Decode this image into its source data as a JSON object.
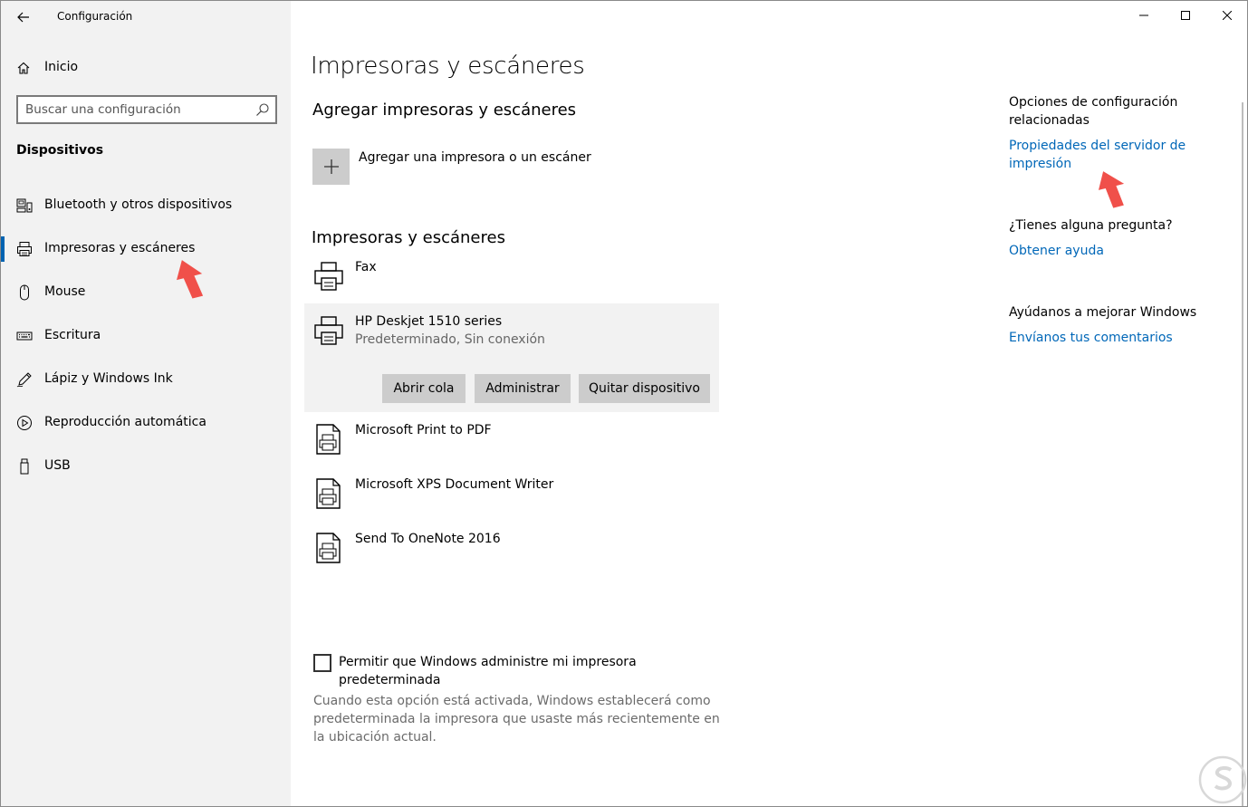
{
  "window": {
    "title": "Configuración"
  },
  "nav": {
    "home_label": "Inicio",
    "search_placeholder": "Buscar una configuración",
    "section": "Dispositivos",
    "items": [
      {
        "label": "Bluetooth y otros dispositivos",
        "icon": "bluetooth-devices-icon"
      },
      {
        "label": "Impresoras y escáneres",
        "icon": "printer-icon",
        "active": true
      },
      {
        "label": "Mouse",
        "icon": "mouse-icon"
      },
      {
        "label": "Escritura",
        "icon": "keyboard-icon"
      },
      {
        "label": "Lápiz y Windows Ink",
        "icon": "pen-icon"
      },
      {
        "label": "Reproducción automática",
        "icon": "autoplay-icon"
      },
      {
        "label": "USB",
        "icon": "usb-icon"
      }
    ]
  },
  "main": {
    "title": "Impresoras y escáneres",
    "add_section_title": "Agregar impresoras y escáneres",
    "add_label": "Agregar una impresora o un escáner",
    "list_title": "Impresoras y escáneres",
    "printers": [
      {
        "name": "Fax",
        "icon": "printer-icon"
      },
      {
        "name": "HP Deskjet 1510 series",
        "status": "Predeterminado, Sin conexión",
        "icon": "printer-icon",
        "selected": true
      },
      {
        "name": "Microsoft Print to PDF",
        "icon": "document-printer-icon"
      },
      {
        "name": "Microsoft XPS Document Writer",
        "icon": "document-printer-icon"
      },
      {
        "name": "Send To OneNote 2016",
        "icon": "document-printer-icon"
      }
    ],
    "buttons": {
      "open_queue": "Abrir cola",
      "manage": "Administrar",
      "remove": "Quitar dispositivo"
    },
    "checkbox_label": "Permitir que Windows administre mi impresora predeterminada",
    "checkbox_checked": false,
    "checkbox_description": "Cuando esta opción está activada, Windows establecerá como predeterminada la impresora que usaste más recientemente en la ubicación actual."
  },
  "related": {
    "heading": "Opciones de configuración relacionadas",
    "link_server": "Propiedades del servidor de impresión",
    "question": "¿Tienes alguna pregunta?",
    "link_help": "Obtener ayuda",
    "improve": "Ayúdanos a mejorar Windows",
    "link_feedback": "Envíanos tus comentarios"
  },
  "colors": {
    "accent": "#0067b8",
    "sidebar_bg": "#f2f2f2",
    "annotation_arrow": "#f0504a"
  }
}
